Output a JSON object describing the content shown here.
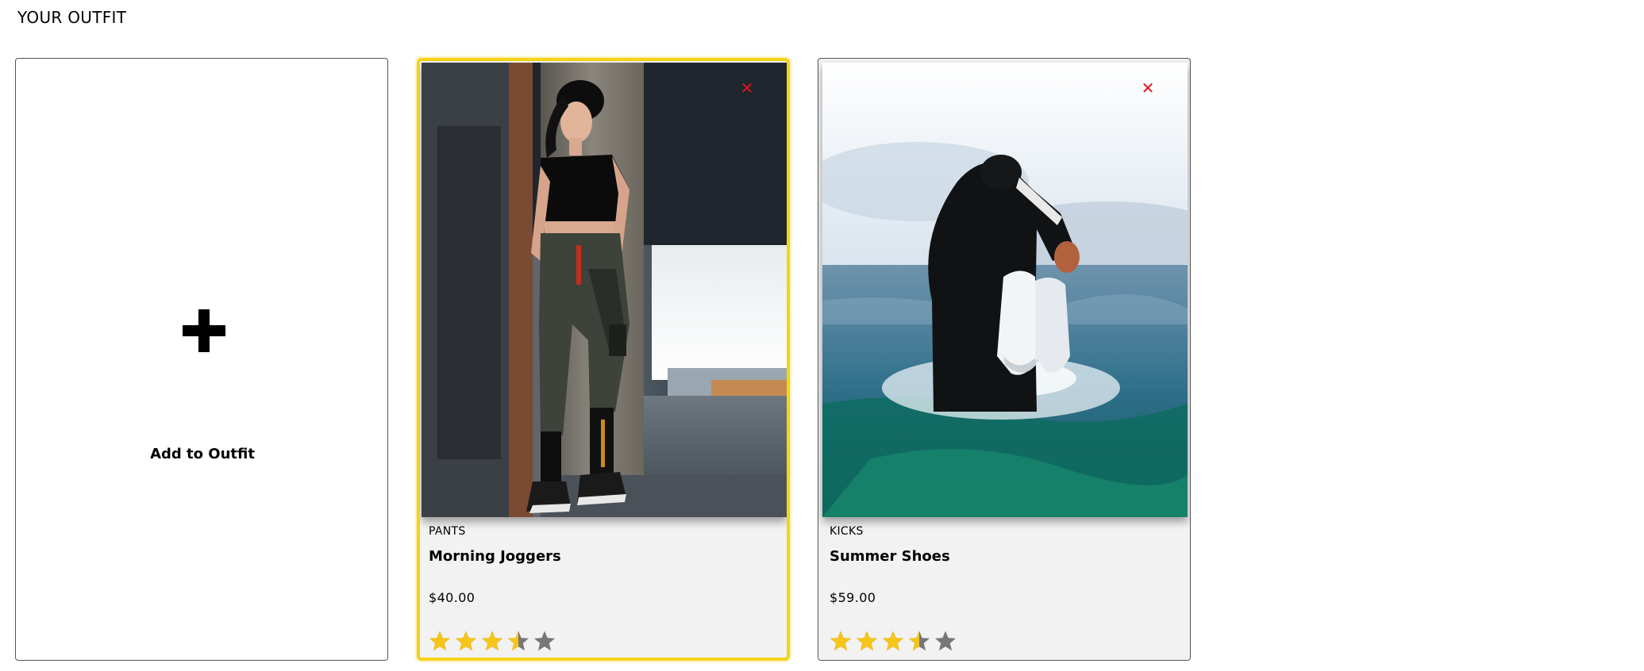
{
  "section_title": "YOUR OUTFIT",
  "add_card": {
    "label": "Add to Outfit",
    "icon": "plus-icon"
  },
  "colors": {
    "selected_border": "#f5d21a",
    "close": "#e0141e",
    "star_filled": "#f5c518",
    "star_empty": "#777777"
  },
  "outfit_items": [
    {
      "category": "PANTS",
      "name": "Morning Joggers",
      "price": "$40.00",
      "rating": 3.5,
      "close_icon": "close-icon",
      "selected": true
    },
    {
      "category": "KICKS",
      "name": "Summer Shoes",
      "price": "$59.00",
      "rating": 3.5,
      "close_icon": "close-icon",
      "selected": false
    }
  ]
}
